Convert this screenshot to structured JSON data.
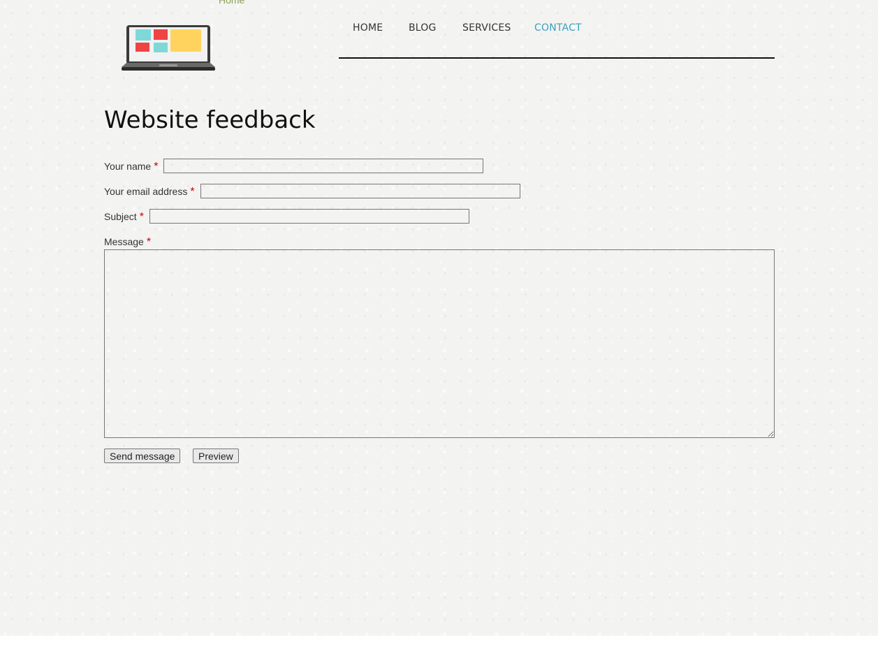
{
  "header": {
    "site_name": "Home",
    "logo_icon": "laptop-logo-icon"
  },
  "nav": {
    "items": [
      {
        "label": "HOME"
      },
      {
        "label": "BLOG"
      },
      {
        "label": "SERVICES"
      },
      {
        "label": "CONTACT",
        "active": true
      }
    ],
    "active_color": "#3aa1bf"
  },
  "page": {
    "title": "Website feedback"
  },
  "form": {
    "required_marker": "*",
    "required_color": "#cc0000",
    "name_label": "Your name",
    "name_value": "",
    "email_label": "Your email address",
    "email_value": "",
    "subject_label": "Subject",
    "subject_value": "",
    "message_label": "Message",
    "message_value": "",
    "send_label": "Send message",
    "preview_label": "Preview"
  }
}
